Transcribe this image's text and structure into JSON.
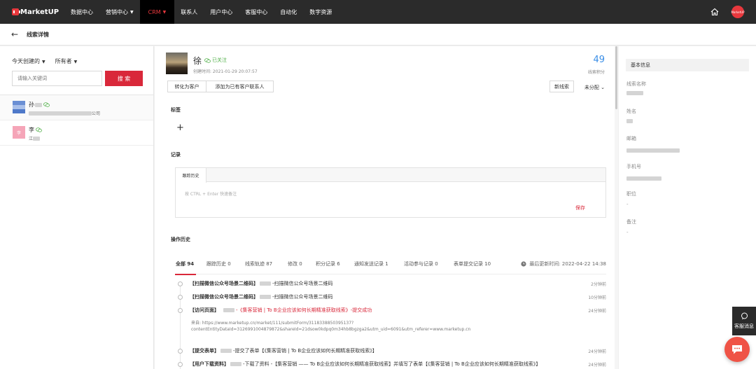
{
  "brand": {
    "logo_text": "MarketUP",
    "accent": "#e8383d",
    "nav_bg": "#2b2b2b"
  },
  "nav": {
    "items": [
      "数据中心",
      "营销中心",
      "CRM",
      "联系人",
      "用户中心",
      "客服中心",
      "自动化",
      "数字资源"
    ],
    "active": "CRM",
    "home_icon": "home-icon",
    "avatar_text": "MarketUP"
  },
  "page": {
    "title": "线索详情",
    "back_icon": "arrow-left-icon"
  },
  "left": {
    "filter_created": "今天创建的",
    "filter_owner": "所有者",
    "search_placeholder": "请输入关键词",
    "search_button": "搜 索",
    "leads": [
      {
        "name": "孙",
        "company_suffix": "公司"
      },
      {
        "name": "李",
        "company_prefix": "江",
        "avatar_text": "李"
      }
    ]
  },
  "main": {
    "name": "徐",
    "followed": "已关注",
    "created": "创建时间: 2021-01-29 20:07:57",
    "score": "49",
    "score_label": "线索积分",
    "btn_convert": "转化为客户",
    "btn_add_contact": "添加为已有客户联系人",
    "btn_new_lead": "新线索",
    "assign": "未分配",
    "tags_title": "标签",
    "plus": "+",
    "record_title": "记录",
    "record_tab": "跟踪历史",
    "record_placeholder": "按 CTRL + Enter 快速备注",
    "record_save": "保存",
    "ops_title": "操作历史",
    "tabs": [
      "全部 94",
      "跟踪历史 0",
      "线索轨迹 87",
      "修改 0",
      "积分记录 6",
      "通知发送记录 1",
      "活动参与记录 0",
      "表单提交记录 10"
    ],
    "last_update": "最后更新时间: 2022-04-22 14:38",
    "timeline": [
      {
        "tag": "【扫描微信公众号场景二维码】",
        "text": "-扫描微信公众号场景二维码",
        "time": "2分钟前"
      },
      {
        "tag": "【扫描微信公众号场景二维码】",
        "text": "-扫描微信公众号场景二维码",
        "time": "10分钟前"
      },
      {
        "tag": "【访问页面】",
        "text": "-《集客营销 | To B企业应该如何长期精准获取线索》-提交成功",
        "time": "24分钟前",
        "source": "来自: https://www.marketup.cn/market/111/submitForm/3118338850395137?",
        "params": "contentEntityDataId=3126991004879872&shareId=21dsow0kdpq0m34hb8bgzga2&utm_uid=6091&utm_referer=www.marketup.cn"
      },
      {
        "tag": "【提交表单】",
        "text": "-提交了表单【《集客营销 | To B企业应该如何长期精准获取线索》】",
        "time": "24分钟前"
      },
      {
        "tag": "【用户下载资料】",
        "text": "-下载了资料 -【集客营销 —— To B企业应该如何长期精准获取线索】并填写了表单【《集客营销 | To B企业应该如何长期精准获取线索》】",
        "time": "24分钟前"
      }
    ]
  },
  "right": {
    "header": "基本信息",
    "fields": [
      {
        "label": "线索名称",
        "value": ""
      },
      {
        "label": "姓名",
        "value": ""
      },
      {
        "label": "邮箱",
        "value": ""
      },
      {
        "label": "手机号",
        "value": ""
      },
      {
        "label": "职位",
        "value": "-"
      },
      {
        "label": "备注",
        "value": "-"
      }
    ]
  },
  "support": {
    "label": "客服消息"
  }
}
